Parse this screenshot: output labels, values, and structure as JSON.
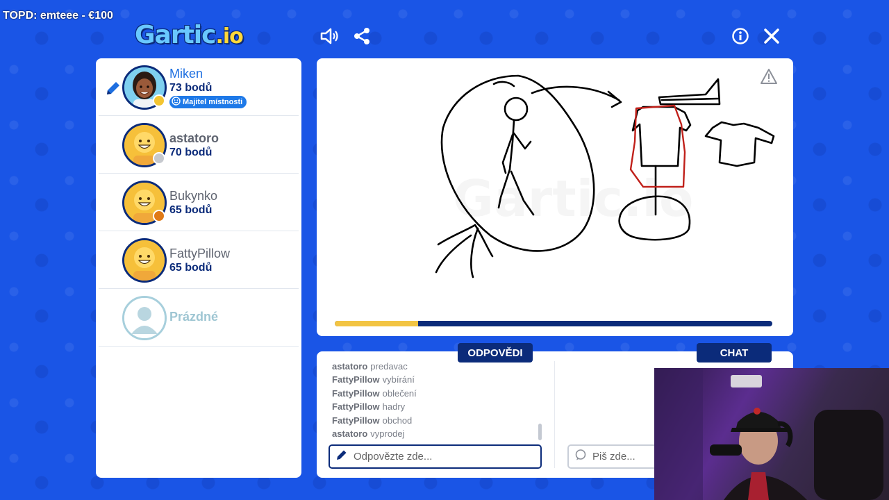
{
  "stream_overlay": {
    "text": "TOPD: emteee - €100"
  },
  "header": {
    "logo_main": "Gartic",
    "logo_suffix": ".io",
    "icons": [
      "speaker-icon",
      "share-icon",
      "info-icon",
      "close-icon"
    ]
  },
  "players": [
    {
      "name": "Miken",
      "points": "73 bodů",
      "badge": "Majitel místnosti",
      "status_color": "#f4c531",
      "drawing": true,
      "avatar": "custom"
    },
    {
      "name": "astatoro",
      "points": "70 bodů",
      "status_color": "#c6c9cf",
      "drawing": false,
      "avatar": "default"
    },
    {
      "name": "Bukynko",
      "points": "65 bodů",
      "status_color": "#e07a17",
      "drawing": false,
      "avatar": "default"
    },
    {
      "name": "FattyPillow",
      "points": "65 bodů",
      "status_color": "",
      "drawing": false,
      "avatar": "default"
    },
    {
      "name": "Prázdné",
      "points": "",
      "status_color": "",
      "drawing": false,
      "avatar": "empty"
    }
  ],
  "canvas": {
    "watermark": "Gartic.io",
    "timer_progress": 0.19,
    "report_icon": "warning-icon"
  },
  "tabs": {
    "answers": "ODPOVĚDI",
    "chat": "CHAT"
  },
  "answers": [
    {
      "user": "astatoro",
      "text": "predavac"
    },
    {
      "user": "FattyPillow",
      "text": "vybírání"
    },
    {
      "user": "FattyPillow",
      "text": "oblečení"
    },
    {
      "user": "FattyPillow",
      "text": "hadry"
    },
    {
      "user": "FattyPillow",
      "text": "obchod"
    },
    {
      "user": "astatoro",
      "text": "vyprodej"
    }
  ],
  "answer_input": {
    "placeholder": "Odpovězte zde...",
    "value": ""
  },
  "chat_input": {
    "placeholder": "Piš zde...",
    "value": ""
  },
  "colors": {
    "background": "#1a55e6",
    "navy": "#0b2b7a",
    "accent_yellow": "#f2c443"
  }
}
